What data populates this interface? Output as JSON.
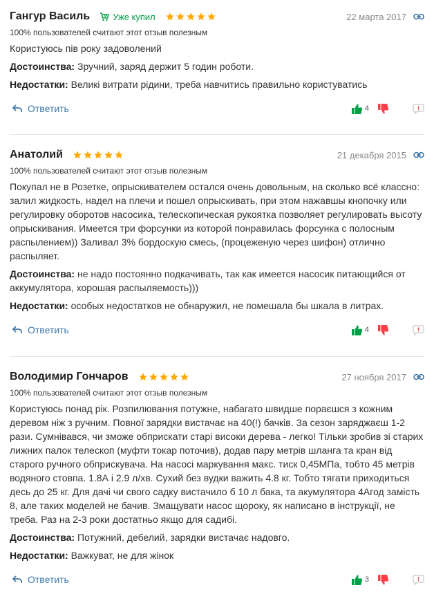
{
  "reviews": [
    {
      "author": "Гангур Василь",
      "bought": "Уже купил",
      "date": "22 марта 2017",
      "helpful": "100% пользователей считают этот отзыв полезным",
      "text": "Користуюсь пів року задоволений",
      "pros_label": "Достоинства:",
      "pros": "Зручний, заряд держит 5 годин роботи.",
      "cons_label": "Недостатки:",
      "cons": "Великі витрати рідини, треба навчитись правильно користуватись",
      "reply": "Ответить",
      "likes": "4",
      "rating": 5
    },
    {
      "author": "Анатолий",
      "date": "21 декабря 2015",
      "helpful": "100% пользователей считают этот отзыв полезным",
      "text": "Покупал не в Розетке, опрыскивателем остался очень довольным, на сколько всё классно: залил жидкость, надел на плечи и пошел опрыскивать, при этом нажавшы кнопочку или регулировку оборотов насосика, телескопическая рукоятка позволяет регулировать высоту опрыскивания. Имеется три форсунки из которой понравилась форсунка с полосным распылением)) Заливал 3% бордоскую смесь, (процеженую через шифон) отлично распыляет.",
      "pros_label": "Достоинства:",
      "pros": "не надо постоянно подкачивать, так как имеется насосик питающийся от аккумулятора, хорошая распыляемость)))",
      "cons_label": "Недостатки:",
      "cons": "особых недостатков не обнаружил, не помешала бы шкала в литрах.",
      "reply": "Ответить",
      "likes": "4",
      "rating": 5
    },
    {
      "author": "Володимир Гончаров",
      "date": "27 ноября 2017",
      "helpful": "100% пользователей считают этот отзыв полезным",
      "text": "Користуюсь понад рік. Розпилювання потужне, набагато швидше пораєшся з кожним деревом ніж з ручним. Повної зарядки вистачає на 40(!) бачків. За сезон заряджаєш 1-2 рази. Сумнівався, чи зможе обприскати старі високи дерева - легко! Тільки зробив зі старих лижних палок телескоп (муфти токар поточив), додав пару метрів шланга та кран від старого ручного обприскувача. На насосі маркування макс. тиск 0,45МПа, тобто 45 метрів водяного стовпа. 1.8А і 2.9 л/хв. Сухий без вудки важить 4.8 кг. Тобто тягати приходиться десь до 25 кг. Для дачі чи свого садку вистачило б 10 л бака, та акумулятора 4Агод замість 8, але таких моделей не бачив. Змащувати насос щороку, як написано в інструкції, не треба. Раз на 2-3 роки достатньо якщо для садибі.",
      "pros_label": "Достоинства:",
      "pros": "Потужний, дебелий, зарядки вистачає надовго.",
      "cons_label": "Недостатки:",
      "cons": "Важкуват, не для жінок",
      "reply": "Ответить",
      "likes": "3",
      "rating": 5
    }
  ],
  "colors": {
    "star": "#ffa900",
    "link": "#3e77aa",
    "bought": "#00a046",
    "like": "#00a046",
    "dislike": "#f84147",
    "complain": "#d0d0d0"
  }
}
